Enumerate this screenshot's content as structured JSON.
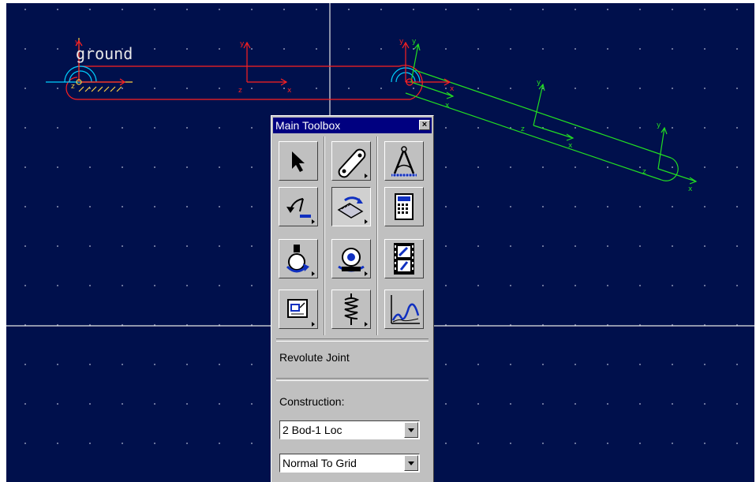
{
  "scene": {
    "ground_label": "ground",
    "axis_labels": {
      "x": "x",
      "y": "y",
      "z": "z"
    },
    "colors": {
      "background": "#00104c",
      "grid_dots": "#8d94b5",
      "ground_part": "#ff2020",
      "link_part": "#22dd22",
      "marker": "#00d0ff",
      "axes_lines": "#e6e6e6"
    }
  },
  "toolbox": {
    "title": "Main Toolbox",
    "close_glyph": "×",
    "tools": [
      {
        "name": "select-tool",
        "icon": "arrow-pointer-icon"
      },
      {
        "name": "part-tool",
        "icon": "link-part-icon"
      },
      {
        "name": "measure-tool",
        "icon": "compass-icon"
      },
      {
        "name": "undo-tool",
        "icon": "undo-arrow-icon"
      },
      {
        "name": "joint-tool",
        "icon": "hinge-icon",
        "pressed": true
      },
      {
        "name": "calculator-tool",
        "icon": "calculator-icon"
      },
      {
        "name": "motion-tool",
        "icon": "rotation-motion-icon"
      },
      {
        "name": "view-tool",
        "icon": "camera-rotate-icon"
      },
      {
        "name": "animation-tool",
        "icon": "film-strip-icon"
      },
      {
        "name": "dialog-tool",
        "icon": "dialog-box-icon"
      },
      {
        "name": "spring-tool",
        "icon": "spring-icon"
      },
      {
        "name": "plot-tool",
        "icon": "plot-curve-icon"
      }
    ],
    "current_tool_label": "Revolute Joint",
    "construction_label": "Construction:",
    "construction_value": "2 Bod-1 Loc",
    "orientation_value": "Normal To Grid"
  }
}
